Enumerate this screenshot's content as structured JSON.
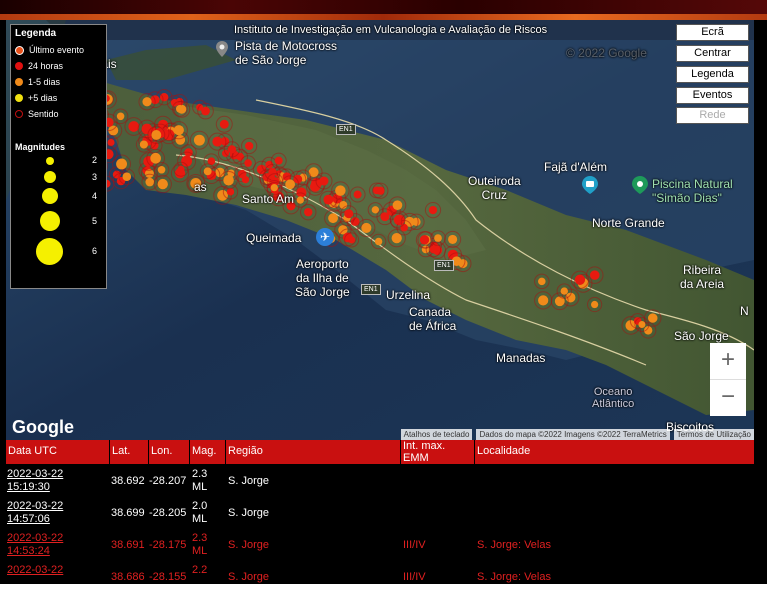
{
  "topbar": {
    "items": [
      "...",
      "...",
      "..."
    ]
  },
  "map": {
    "header": "Instituto de Investigação em Vulcanologia e Avaliação de Riscos",
    "watermark": "© 2022 Google",
    "controls": [
      "Ecrã",
      "Centrar",
      "Legenda",
      "Eventos",
      "Rede"
    ],
    "places": {
      "rosais": "Rosais",
      "pista": "Pista de Motocross\nde São Jorge",
      "faja": "Fajã d'Além",
      "piscina": "Piscina Natural\n\"Simão Dias\"",
      "outeiroda": "Outeiroda\nCruz",
      "norte": "Norte Grande",
      "santo": "Santo Am",
      "queimada": "Queimada",
      "aeroporto": "Aeroporto\nda Ilha de\nSão Jorge",
      "urzelina": "Urzelina",
      "canada": "Canada\nde África",
      "manadas": "Manadas",
      "ribeira": "Ribeira\nda Areia",
      "saojorge": "São Jorge",
      "oceano": "Oceano\nAtlântico",
      "biscoitos": "Biscoitos",
      "velas": "as",
      "n": "N"
    },
    "roads": [
      "EN1",
      "EN1",
      "EN1"
    ],
    "zoom_in": "+",
    "zoom_out": "−",
    "google": "Google",
    "attribution": [
      "Atalhos de teclado",
      "Dados do mapa ©2022 Imagens ©2022 TerraMetrics",
      "Termos de Utilização"
    ]
  },
  "legend": {
    "title": "Legenda",
    "items": [
      {
        "label": "Último evento",
        "color": "#e8501a"
      },
      {
        "label": "24 horas",
        "color": "#e01010"
      },
      {
        "label": "1-5 dias",
        "color": "#f08a1a"
      },
      {
        "label": "+5 dias",
        "color": "#f0e010"
      },
      {
        "label": "Sentido",
        "color": "#a01010"
      }
    ],
    "magnitudes_title": "Magnitudes",
    "magnitudes": [
      "2",
      "3",
      "4",
      "5",
      "6"
    ]
  },
  "table": {
    "headers": [
      "Data UTC",
      "Lat.",
      "Lon.",
      "Mag.",
      "Região",
      "Int. max.\nEMM",
      "Localidade"
    ],
    "rows": [
      {
        "date": "2022-03-22\n15:19:30",
        "lat": "38.692",
        "lon": "-28.207",
        "mag": "2.3\nML",
        "region": "S. Jorge",
        "emm": "",
        "local": "",
        "style": "black"
      },
      {
        "date": "2022-03-22\n14:57:06",
        "lat": "38.699",
        "lon": "-28.205",
        "mag": "2.0\nML",
        "region": "S. Jorge",
        "emm": "",
        "local": "",
        "style": "black"
      },
      {
        "date": "2022-03-22\n14:53:24",
        "lat": "38.691",
        "lon": "-28.175",
        "mag": "2.3\nML",
        "region": "S. Jorge",
        "emm": "III/IV",
        "local": "S. Jorge: Velas",
        "style": "red"
      },
      {
        "date": "2022-03-22\n",
        "lat": "38.686",
        "lon": "-28.155",
        "mag": "2.2\n",
        "region": "S. Jorge",
        "emm": "III/IV",
        "local": "S. Jorge: Velas",
        "style": "red"
      }
    ]
  }
}
